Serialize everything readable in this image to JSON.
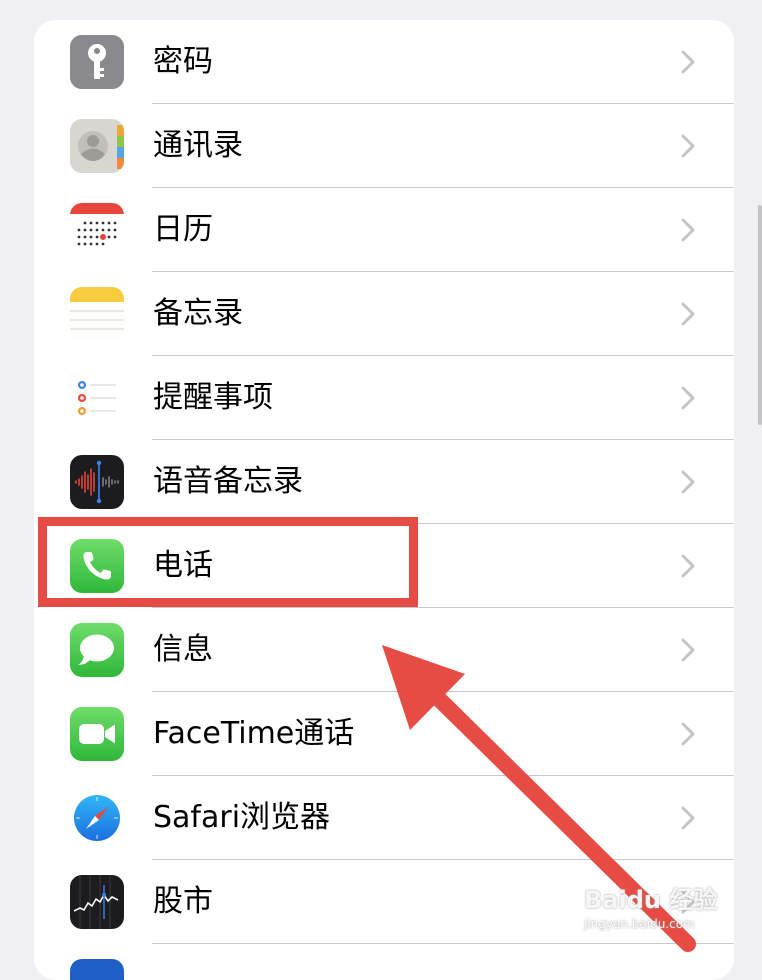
{
  "rows": [
    {
      "label": "密码",
      "icon": "key-icon"
    },
    {
      "label": "通讯录",
      "icon": "contacts-icon"
    },
    {
      "label": "日历",
      "icon": "calendar-icon"
    },
    {
      "label": "备忘录",
      "icon": "notes-icon"
    },
    {
      "label": "提醒事项",
      "icon": "reminders-icon"
    },
    {
      "label": "语音备忘录",
      "icon": "voice-memos-icon"
    },
    {
      "label": "电话",
      "icon": "phone-icon"
    },
    {
      "label": "信息",
      "icon": "messages-icon"
    },
    {
      "label": "FaceTime通话",
      "icon": "facetime-icon"
    },
    {
      "label": "Safari浏览器",
      "icon": "safari-icon"
    },
    {
      "label": "股市",
      "icon": "stocks-icon"
    }
  ],
  "annotation": {
    "color": "#e74c44"
  },
  "watermark": {
    "logo": "Baidu 经验",
    "sub": "jingyan.baidu.com"
  }
}
